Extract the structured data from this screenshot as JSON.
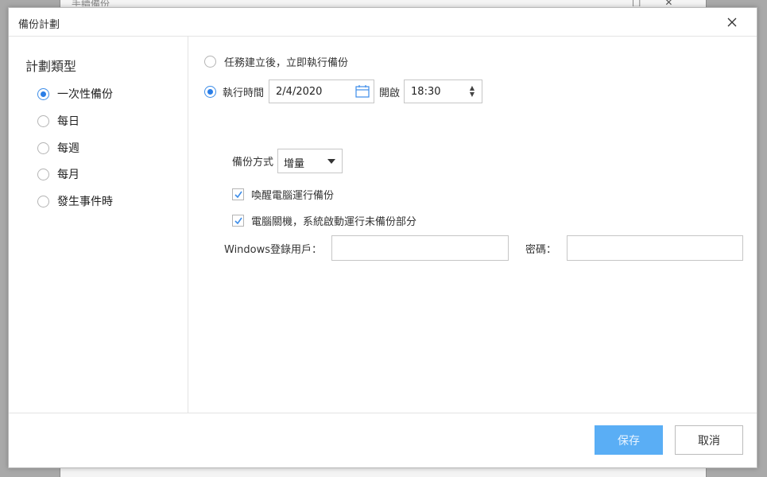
{
  "background": {
    "title": "手續備份"
  },
  "dialog": {
    "title": "備份計劃"
  },
  "sidebar": {
    "title": "計劃類型",
    "items": [
      {
        "label": "一次性備份",
        "checked": true
      },
      {
        "label": "每日",
        "checked": false
      },
      {
        "label": "每週",
        "checked": false
      },
      {
        "label": "每月",
        "checked": false
      },
      {
        "label": "發生事件時",
        "checked": false
      }
    ]
  },
  "main": {
    "option_immediate": "任務建立後，立即執行備份",
    "option_scheduled": "執行時間",
    "date_value": "2/4/2020",
    "start_label": "開啟",
    "time_value": "18:30",
    "method_label": "備份方式",
    "method_value": "增量",
    "checkbox_wake": "喚醒電腦運行備份",
    "checkbox_shutdown": "電腦關機，系統啟動運行未備份部分",
    "windows_user_label": "Windows登錄用戶：",
    "password_label": "密碼："
  },
  "footer": {
    "save_label": "保存",
    "cancel_label": "取消"
  },
  "colors": {
    "accent": "#2b7ee6",
    "save_button": "#5aaef5"
  },
  "icons": [
    "close-icon",
    "calendar-icon",
    "spinner-icon",
    "dropdown-arrow-icon",
    "checkmark-icon"
  ]
}
